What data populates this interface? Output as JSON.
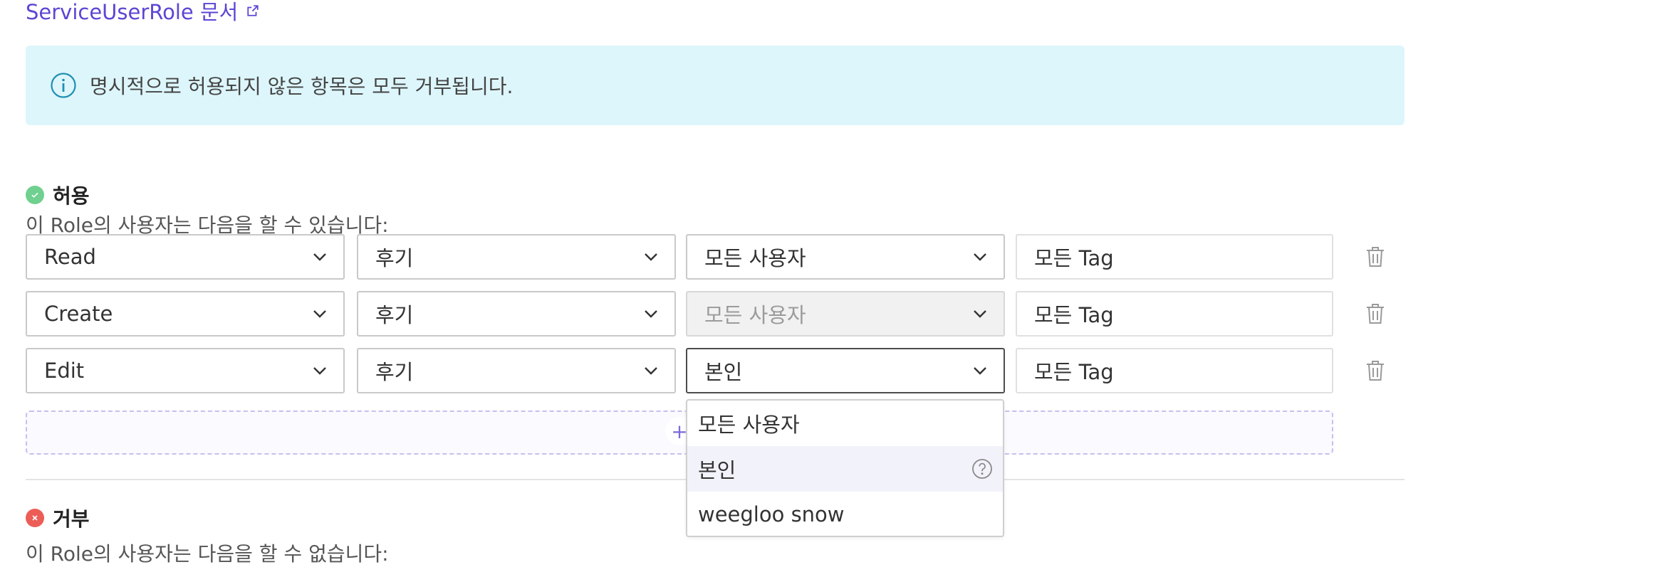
{
  "doc_link": {
    "label": "ServiceUserRole 문서"
  },
  "info_banner": {
    "text": "명시적으로 허용되지 않은 항목은 모두 거부됩니다."
  },
  "allow_section": {
    "title": "허용",
    "description": "이 Role의 사용자는 다음을 할 수 있습니다:",
    "rules": [
      {
        "action": "Read",
        "resource": "후기",
        "scope": "모든 사용자",
        "scope_disabled": false,
        "tag": "모든 Tag"
      },
      {
        "action": "Create",
        "resource": "후기",
        "scope": "모든 사용자",
        "scope_disabled": true,
        "tag": "모든 Tag"
      },
      {
        "action": "Edit",
        "resource": "후기",
        "scope": "본인",
        "scope_disabled": false,
        "tag": "모든 Tag"
      }
    ]
  },
  "scope_dropdown": {
    "options": [
      "모든 사용자",
      "본인",
      "weegloo snow"
    ],
    "highlighted": "본인"
  },
  "deny_section": {
    "title": "거부",
    "description": "이 Role의 사용자는 다음을 할 수 없습니다:"
  },
  "colors": {
    "accent": "#5b46d4",
    "info_bg": "#ddf6fb",
    "allow_green": "#6fd08f",
    "deny_red": "#ec5d57"
  }
}
